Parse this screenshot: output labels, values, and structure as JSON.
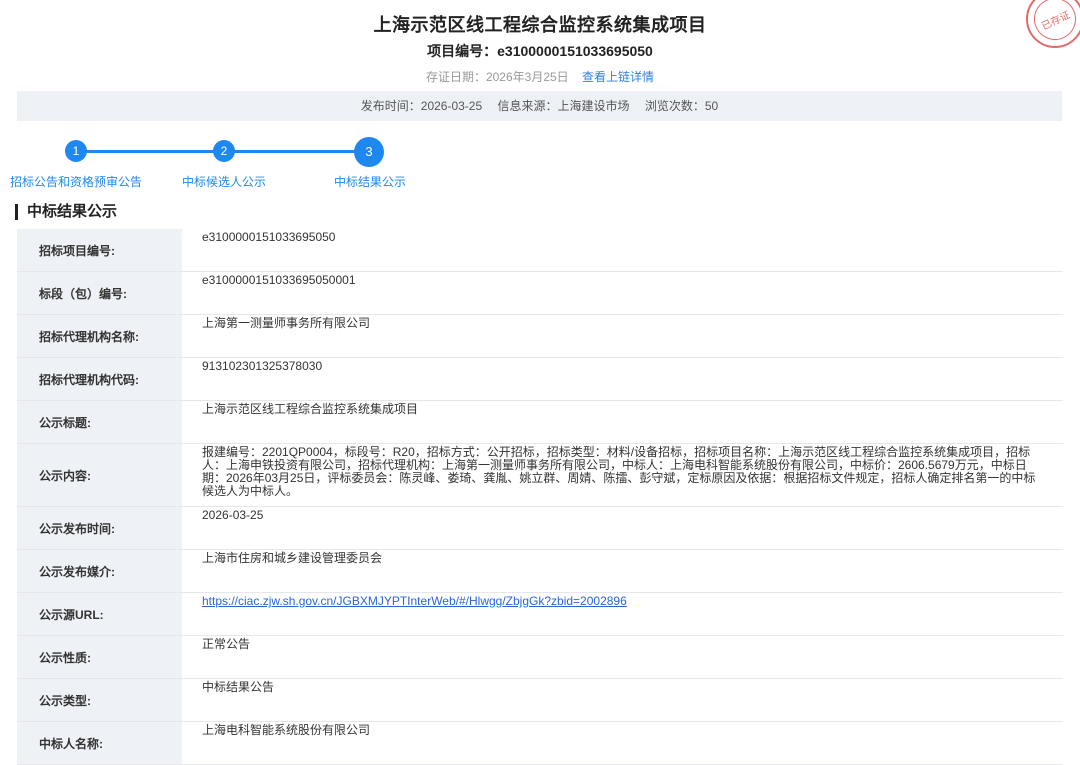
{
  "header": {
    "title": "上海示范区线工程综合监控系统集成项目",
    "project_no": "项目编号：e3100000151033695050",
    "evidence_date": "存证日期：2026年3月25日",
    "evidence_link": "查看上链详情",
    "seal_text": "已存证"
  },
  "meta": {
    "publish_time": "发布时间：2026-03-25",
    "source": "信息来源：上海建设市场",
    "views": "浏览次数：50"
  },
  "steps": [
    {
      "num": "1",
      "label": "招标公告和资格预审公告"
    },
    {
      "num": "2",
      "label": "中标候选人公示"
    },
    {
      "num": "3",
      "label": "中标结果公示"
    }
  ],
  "section_title": "中标结果公示",
  "rows": [
    {
      "label": "招标项目编号:",
      "value": "e3100000151033695050"
    },
    {
      "label": "标段（包）编号:",
      "value": "e3100000151033695050001"
    },
    {
      "label": "招标代理机构名称:",
      "value": "上海第一测量师事务所有限公司"
    },
    {
      "label": "招标代理机构代码:",
      "value": "913102301325378030"
    },
    {
      "label": "公示标题:",
      "value": "上海示范区线工程综合监控系统集成项目"
    },
    {
      "label": "公示内容:",
      "value": "报建编号：2201QP0004，标段号：R20，招标方式：公开招标，招标类型：材料/设备招标，招标项目名称：上海示范区线工程综合监控系统集成项目，招标人：上海申铁投资有限公司，招标代理机构：上海第一测量师事务所有限公司，中标人：上海电科智能系统股份有限公司，中标价：2606.5679万元，中标日期：2026年03月25日，评标委员会：陈灵峰、娄琦、龚胤、姚立群、周婧、陈擂、彭守斌，定标原因及依据：根据招标文件规定，招标人确定排名第一的中标候选人为中标人。"
    },
    {
      "label": "公示发布时间:",
      "value": "2026-03-25"
    },
    {
      "label": "公示发布媒介:",
      "value": "上海市住房和城乡建设管理委员会"
    },
    {
      "label": "公示源URL:",
      "value": "https://ciac.zjw.sh.gov.cn/JGBXMJYPTInterWeb/#/Hlwgg/ZbjgGk?zbid=2002896"
    },
    {
      "label": "公示性质:",
      "value": "正常公告"
    },
    {
      "label": "公示类型:",
      "value": "中标结果公告"
    },
    {
      "label": "中标人名称:",
      "value": "上海电科智能系统股份有限公司"
    }
  ]
}
